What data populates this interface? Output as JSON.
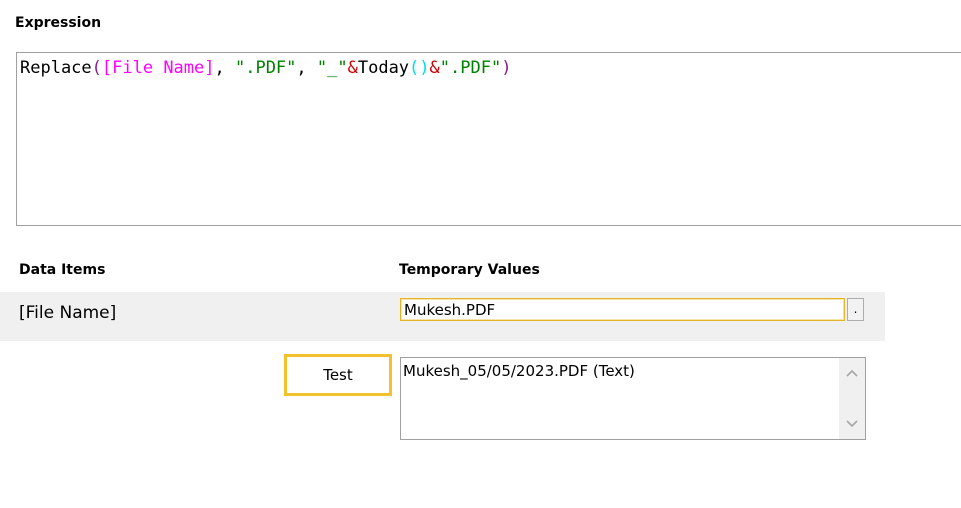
{
  "expression": {
    "label": "Expression",
    "tokens": [
      {
        "text": "Replace",
        "kind": "fn"
      },
      {
        "text": "(",
        "kind": "par"
      },
      {
        "text": "[File Name]",
        "kind": "ref"
      },
      {
        "text": ", ",
        "kind": "punc"
      },
      {
        "text": "\".PDF\"",
        "kind": "str"
      },
      {
        "text": ", ",
        "kind": "punc"
      },
      {
        "text": "\"_\"",
        "kind": "str"
      },
      {
        "text": "&",
        "kind": "op"
      },
      {
        "text": "Today",
        "kind": "fn"
      },
      {
        "text": "()",
        "kind": "par2"
      },
      {
        "text": "&",
        "kind": "op"
      },
      {
        "text": "\".PDF\"",
        "kind": "str"
      },
      {
        "text": ")",
        "kind": "par"
      }
    ]
  },
  "data_items": {
    "header_items": "Data Items",
    "header_values": "Temporary Values",
    "rows": [
      {
        "name": "[File Name]",
        "value": "Mukesh.PDF",
        "button_label": "."
      }
    ]
  },
  "test": {
    "button_label": "Test",
    "result": "Mukesh_05/05/2023.PDF (Text)"
  },
  "icons": {
    "scroll_up": "chevron-up-icon",
    "scroll_down": "chevron-down-icon"
  },
  "colors": {
    "focus_border": "#f2c22e",
    "function": "#000000",
    "paren": "#8b1a8b",
    "reference": "#ff00ff",
    "string": "#008000",
    "operator": "#cc0000",
    "inner_paren": "#00e0e0"
  }
}
